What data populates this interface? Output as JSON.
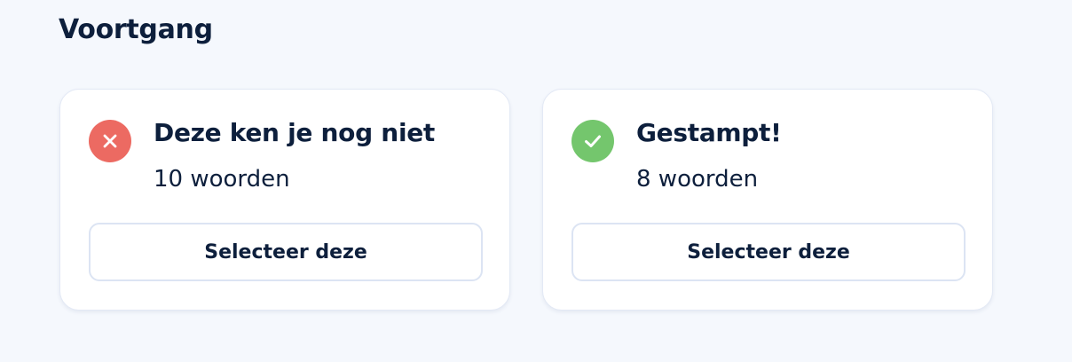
{
  "section": {
    "title": "Voortgang"
  },
  "cards": [
    {
      "icon": "x-icon",
      "icon_color": "#ec6a62",
      "title": "Deze ken je nog niet",
      "count": "10 woorden",
      "button_label": "Selecteer deze"
    },
    {
      "icon": "check-icon",
      "icon_color": "#74c66d",
      "title": "Gestampt!",
      "count": "8 woorden",
      "button_label": "Selecteer deze"
    }
  ]
}
